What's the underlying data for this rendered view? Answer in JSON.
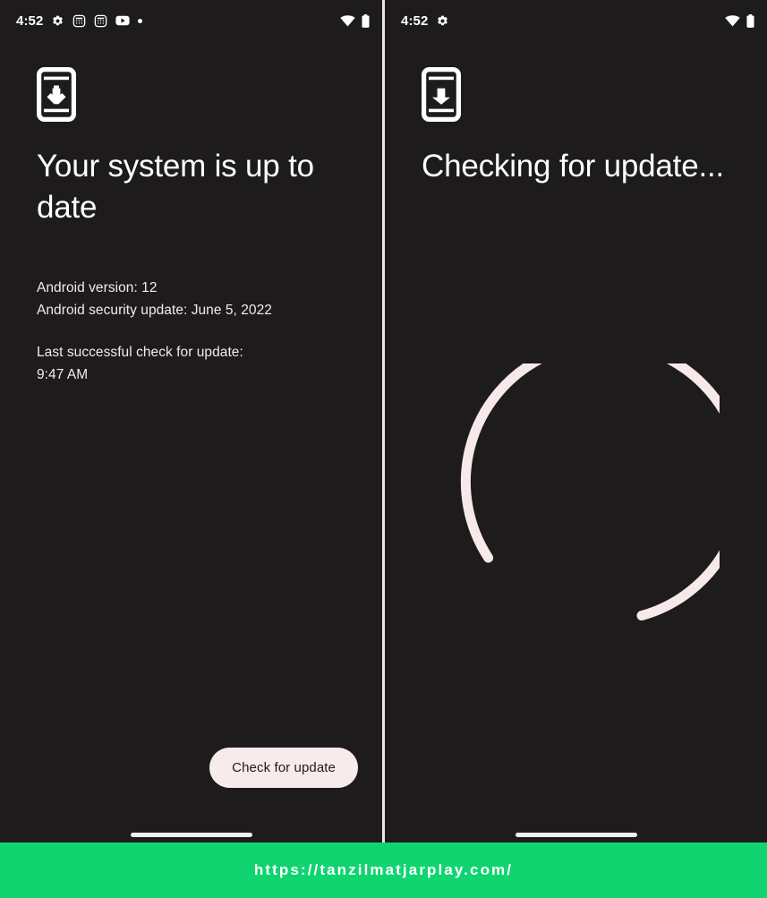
{
  "watermark": {
    "url": "https://tanzilmatjarplay.com/",
    "background_color": "#10d470",
    "text_color": "#ffffff"
  },
  "theme": {
    "screen_background": "#1e1b1c",
    "primary_text": "#ffffff",
    "secondary_text": "#efeced",
    "accent": "#f7ebec"
  },
  "screens": [
    {
      "name": "system-update-up-to-date",
      "status_bar": {
        "time": "4:52",
        "left_icons": [
          "gear-icon",
          "calculator-app-icon",
          "calculator-app-icon",
          "youtube-icon",
          "dot-icon"
        ],
        "right_icons": [
          "wifi-icon",
          "battery-icon"
        ]
      },
      "header_icon": "system-update-icon",
      "headline": "Your system is up to date",
      "details": {
        "android_version": "Android version: 12",
        "security_update": "Android security update: June 5, 2022",
        "last_check_label": "Last successful check for update:",
        "last_check_time": "9:47 AM"
      },
      "button": "Check for update"
    },
    {
      "name": "system-update-checking",
      "status_bar": {
        "time": "4:52",
        "left_icons": [
          "gear-icon"
        ],
        "right_icons": [
          "wifi-icon",
          "battery-icon"
        ]
      },
      "header_icon": "system-update-icon",
      "headline": "Checking for update...",
      "spinner": "loading-spinner"
    }
  ]
}
